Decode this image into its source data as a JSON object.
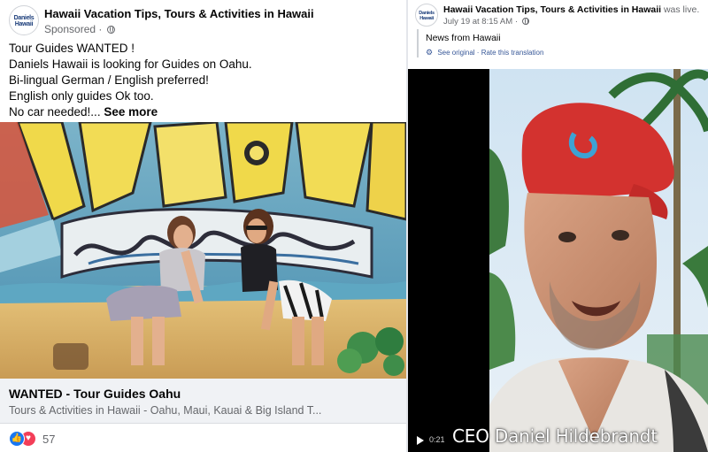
{
  "left_post": {
    "page_name": "Hawaii Vacation Tips, Tours & Activities in Hawaii",
    "avatar_text_1": "Daniels",
    "avatar_text_2": "Hawaii",
    "sponsored": "Sponsored",
    "separator": "·",
    "text_lines": [
      "Tour Guides WANTED !",
      "Daniels Hawaii is looking for Guides on Oahu.",
      "Bi-lingual German / English preferred!",
      "English only guides Ok too.",
      "No car needed!..."
    ],
    "see_more": "See more",
    "link_title": "WANTED - Tour Guides Oahu",
    "link_description": "Tours & Activities in Hawaii - Oahu, Maui, Kauai & Big Island T...",
    "reaction_count": "57",
    "reaction_icons": [
      "like-icon",
      "love-icon"
    ]
  },
  "right_post": {
    "page_name": "Hawaii Vacation Tips, Tours & Activities in Hawaii",
    "was_live": "was live.",
    "avatar_text_1": "Daniels",
    "avatar_text_2": "Hawaii",
    "timestamp": "July 19 at 8:15 AM",
    "separator": "·",
    "text": "News from Hawaii",
    "see_original": "See original",
    "rate_translation": "Rate this translation",
    "translate_separator": "·",
    "video_time": "0:21",
    "caption": "CEO Daniel Hildebrandt"
  },
  "colors": {
    "link_blue": "#385898",
    "secondary_text": "#65676b",
    "like_blue": "#1877f2",
    "love_red": "#f33e58"
  }
}
